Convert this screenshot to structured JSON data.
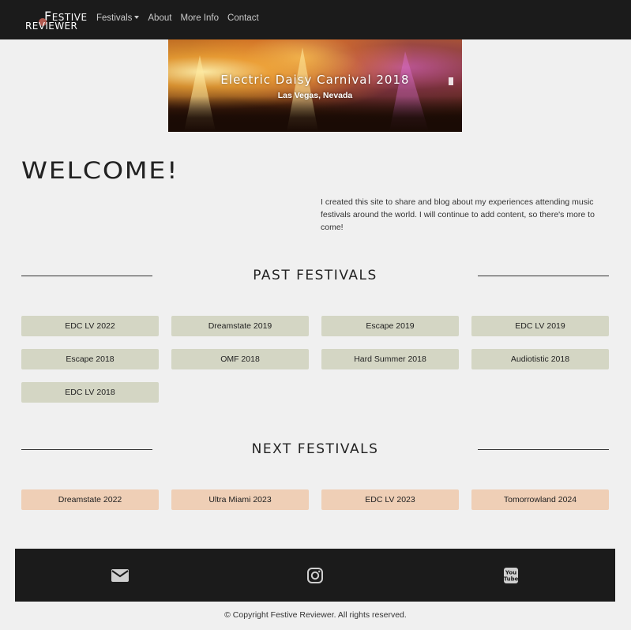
{
  "navbar": {
    "logo_top": "ESTIVE",
    "logo_top_initial": "F",
    "logo_bottom": "REVIEWER",
    "links": [
      {
        "label": "Festivals",
        "dropdown": true
      },
      {
        "label": "About"
      },
      {
        "label": "More Info"
      },
      {
        "label": "Contact"
      }
    ]
  },
  "hero": {
    "title": "Electric Daisy Carnival 2018",
    "subtitle": "Las Vegas, Nevada"
  },
  "welcome": {
    "heading": "WELCOME!",
    "text": "I created this site to share and blog about my experiences attending music festivals around the world. I will continue to add content, so there's more to come!"
  },
  "past": {
    "heading": "PAST FESTIVALS",
    "items": [
      "EDC LV 2022",
      "Dreamstate 2019",
      "Escape 2019",
      "EDC LV 2019",
      "Escape 2018",
      "OMF 2018",
      "Hard Summer 2018",
      "Audiotistic 2018",
      "EDC LV 2018"
    ]
  },
  "next": {
    "heading": "NEXT FESTIVALS",
    "items": [
      "Dreamstate 2022",
      "Ultra Miami 2023",
      "EDC LV 2023",
      "Tomorrowland 2024"
    ]
  },
  "footer": {
    "icons": [
      "envelope-icon",
      "instagram-icon",
      "youtube-icon"
    ],
    "youtube_text_top": "You",
    "youtube_text_bottom": "Tube",
    "copyright": "© Copyright Festive Reviewer. All rights reserved."
  },
  "colors": {
    "nav_bg": "#1b1b1b",
    "page_bg": "#f0f0f0",
    "past_button": "#d4d6c4",
    "next_button": "#efcfb6",
    "logo_dot": "#b0584e"
  }
}
